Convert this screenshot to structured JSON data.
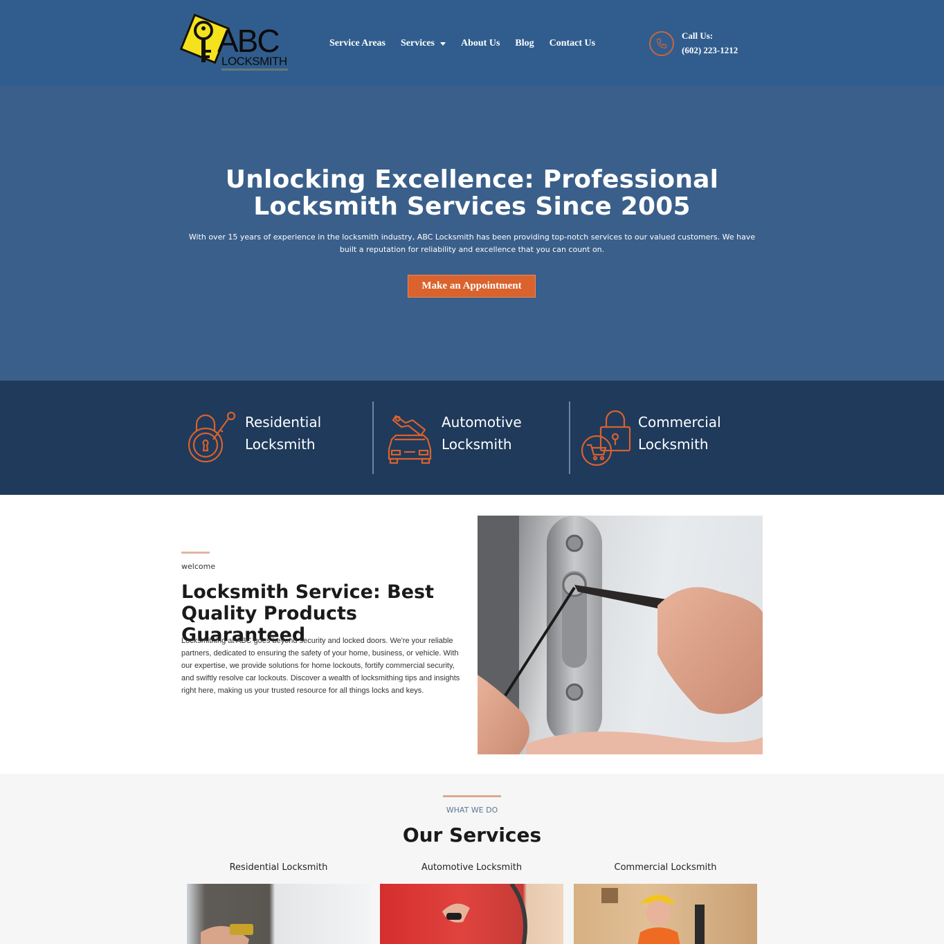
{
  "header": {
    "logo_text": "ABC",
    "logo_sub": "LOCKSMITH",
    "nav": [
      {
        "label": "Service Areas"
      },
      {
        "label": "Services",
        "has_dropdown": true
      },
      {
        "label": "About Us"
      },
      {
        "label": "Blog"
      },
      {
        "label": "Contact Us"
      }
    ],
    "call_label": "Call Us:",
    "call_number": "(602) 223-1212"
  },
  "hero": {
    "title": "Unlocking Excellence: Professional Locksmith Services Since 2005",
    "text": "With over 15 years of experience in the locksmith industry, ABC Locksmith has been providing top-notch services to our valued customers. We have built a reputation for reliability and excellence that you can count on.",
    "button": "Make an Appointment"
  },
  "band": {
    "items": [
      {
        "label": "Residential Locksmith",
        "icon": "padlock-key-icon"
      },
      {
        "label": "Automotive Locksmith",
        "icon": "car-key-icon"
      },
      {
        "label": "Commercial Locksmith",
        "icon": "padlock-cart-icon"
      }
    ]
  },
  "welcome": {
    "eyebrow": "welcome",
    "title": "Locksmith Service: Best Quality Products Guaranteed",
    "text": "Locksmithing at ABC goes beyond security and locked doors. We're your reliable partners, dedicated to ensuring the safety of your home, business, or vehicle. With our expertise, we provide solutions for home lockouts, fortify commercial security, and swiftly resolve car lockouts. Discover a wealth of locksmithing tips and insights right here, making us your trusted resource for all things locks and keys."
  },
  "services": {
    "eyebrow": "WHAT WE DO",
    "title": "Our Services",
    "cards": [
      {
        "title": "Residential Locksmith"
      },
      {
        "title": "Automotive Locksmith"
      },
      {
        "title": "Commercial Locksmith"
      }
    ]
  },
  "colors": {
    "header_bg": "#305d8d",
    "hero_bg": "#3a5f8a",
    "band_bg": "#1f3a5b",
    "accent": "#d9622d",
    "logo_yellow": "#f3e21c"
  }
}
